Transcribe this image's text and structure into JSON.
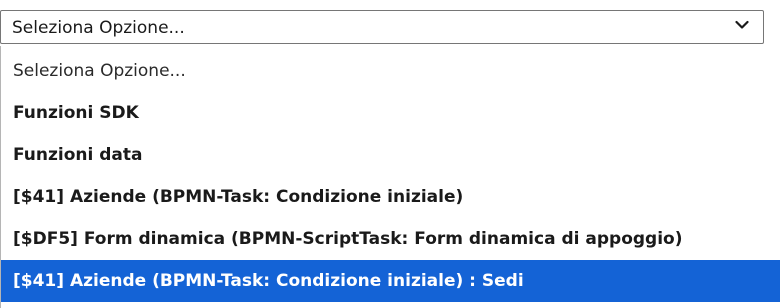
{
  "select": {
    "value": "Seleziona Opzione...",
    "chevron_icon": "chevron-down-icon"
  },
  "options": [
    {
      "label": "Seleziona Opzione...",
      "bold": false,
      "selected": false
    },
    {
      "label": "Funzioni SDK",
      "bold": true,
      "selected": false
    },
    {
      "label": "Funzioni data",
      "bold": true,
      "selected": false
    },
    {
      "label": "[$41] Aziende (BPMN-Task: Condizione iniziale)",
      "bold": true,
      "selected": false
    },
    {
      "label": "[$DF5] Form dinamica (BPMN-ScriptTask: Form dinamica di appoggio)",
      "bold": true,
      "selected": false
    },
    {
      "label": "[$41] Aziende (BPMN-Task: Condizione iniziale) : Sedi",
      "bold": true,
      "selected": true
    }
  ],
  "colors": {
    "highlight": "#1463d6",
    "border": "#767676"
  }
}
